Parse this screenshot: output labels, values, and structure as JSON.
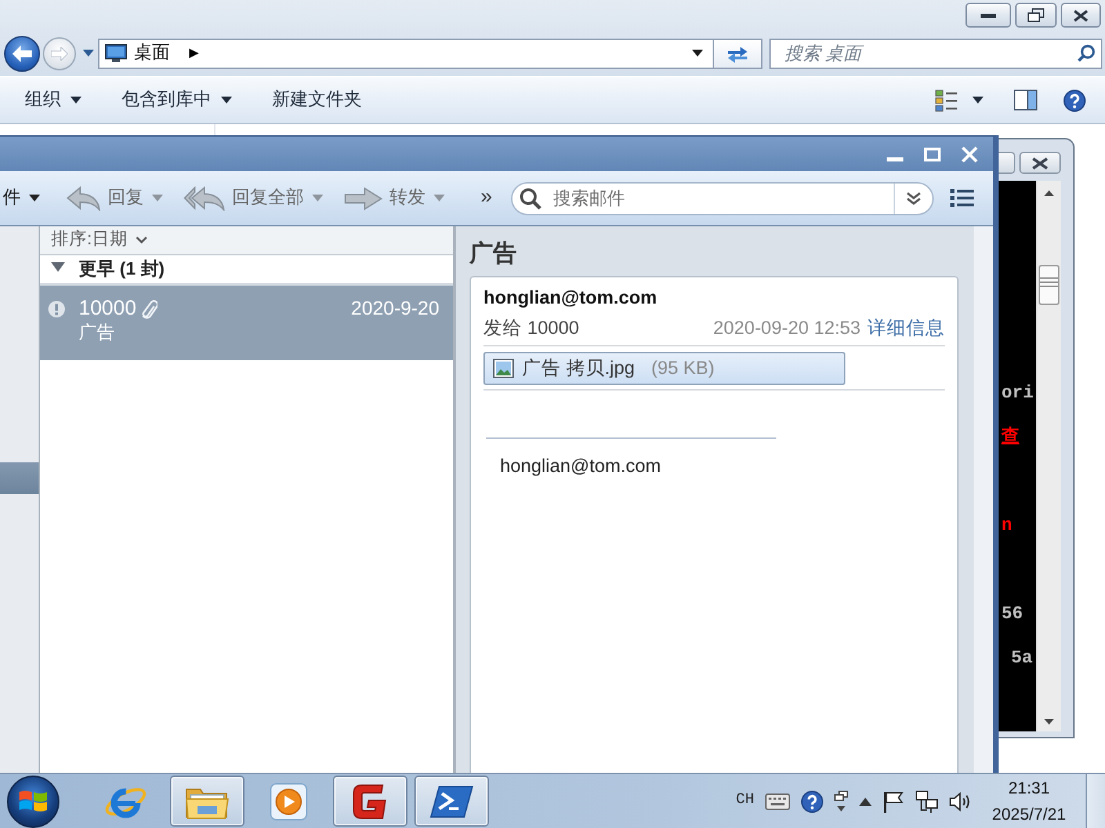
{
  "explorer": {
    "location": "桌面",
    "breadcrumb_arrow": "▶",
    "search": {
      "placeholder": "搜索 桌面"
    },
    "commands": [
      {
        "label": "组织",
        "dropdown": true
      },
      {
        "label": "包含到库中",
        "dropdown": true
      },
      {
        "label": "新建文件夹",
        "dropdown": false
      }
    ]
  },
  "console": {
    "lines": [
      {
        "text": "ori",
        "color": "#c0c0c0",
        "underline": false
      },
      {
        "text": "查",
        "color": "#ff0000",
        "underline": true
      },
      {
        "text": "n",
        "color": "#ff0000",
        "underline": false
      },
      {
        "text": "56",
        "color": "#c0c0c0",
        "underline": false
      },
      {
        "text": "5a",
        "color": "#c0c0c0",
        "underline": false
      }
    ]
  },
  "mail": {
    "toolbar": [
      {
        "kind": "menu",
        "label": "件",
        "disabled": false
      },
      {
        "kind": "reply",
        "label": "回复",
        "disabled": true
      },
      {
        "kind": "reply_all",
        "label": "回复全部",
        "disabled": true
      },
      {
        "kind": "forward",
        "label": "转发",
        "disabled": true
      }
    ],
    "overflow": "»",
    "search": {
      "placeholder": "搜索邮件"
    },
    "folder_pane": {
      "selected_row": true
    },
    "list": {
      "sort_label": "排序:日期",
      "groups": [
        {
          "label": "更早 (1 封)",
          "expanded": true,
          "messages": [
            {
              "sender": "10000",
              "subject": "广告",
              "date": "2020-9-20",
              "important": true,
              "attachment": true,
              "selected": true
            }
          ]
        }
      ]
    },
    "reading": {
      "subject": "广告",
      "from": "honglian@tom.com",
      "to": "发给 10000",
      "sent": "2020-09-20 12:53",
      "details_link": "详细信息",
      "attachments": [
        {
          "name": "广告 拷贝.jpg",
          "size": "(95 KB)"
        }
      ],
      "body": [
        "honglian@tom.com"
      ]
    }
  },
  "taskbar": {
    "apps": [
      {
        "kind": "ie",
        "running": false
      },
      {
        "kind": "folder",
        "running": true
      },
      {
        "kind": "media",
        "running": false
      },
      {
        "kind": "app",
        "running": true
      },
      {
        "kind": "powershell",
        "running": true
      }
    ],
    "tray": {
      "language": "CH",
      "time": "21:31",
      "date": "2025/7/21"
    }
  }
}
